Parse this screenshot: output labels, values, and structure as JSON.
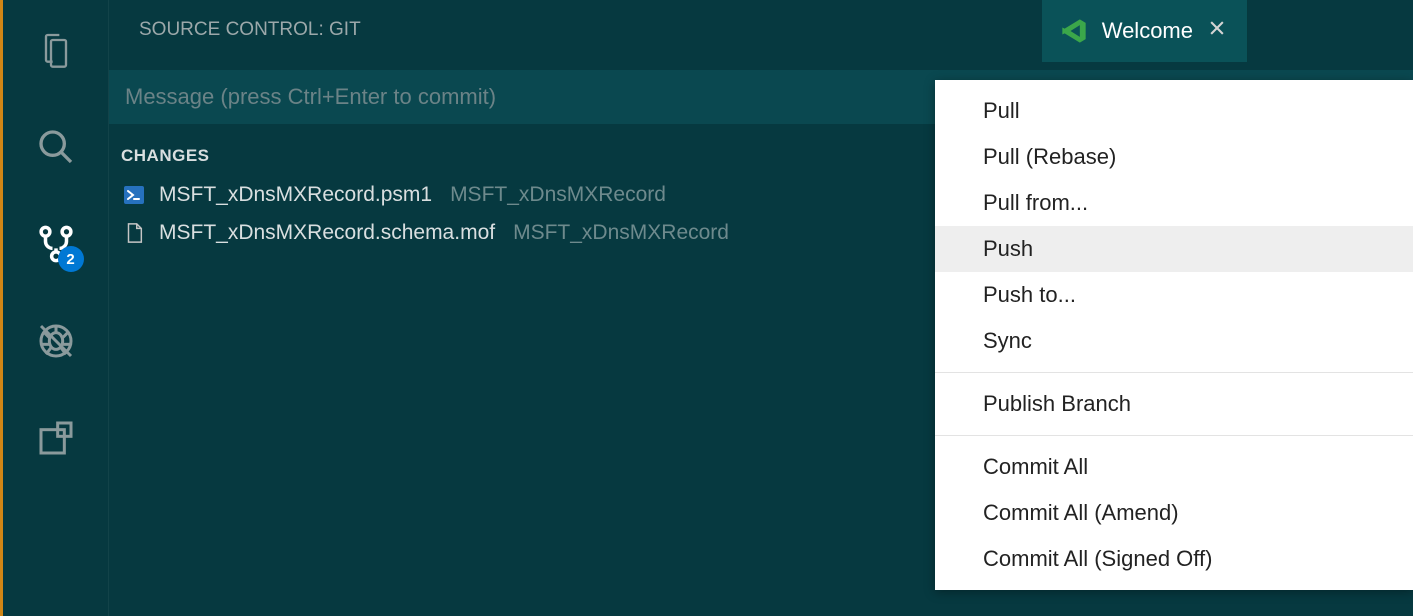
{
  "activity": {
    "scm_badge": "2"
  },
  "sidebar": {
    "title": "SOURCE CONTROL: GIT",
    "commit_placeholder": "Message (press Ctrl+Enter to commit)",
    "section_label": "CHANGES",
    "changes": [
      {
        "name": "MSFT_xDnsMXRecord.psm1",
        "dir": "MSFT_xDnsMXRecord",
        "icon": "powershell"
      },
      {
        "name": "MSFT_xDnsMXRecord.schema.mof",
        "dir": "MSFT_xDnsMXRecord",
        "icon": "file"
      }
    ]
  },
  "tab": {
    "label": "Welcome"
  },
  "menu": {
    "items": [
      {
        "label": "Pull",
        "hover": false
      },
      {
        "label": "Pull (Rebase)",
        "hover": false
      },
      {
        "label": "Pull from...",
        "hover": false
      },
      {
        "label": "Push",
        "hover": true
      },
      {
        "label": "Push to...",
        "hover": false
      },
      {
        "label": "Sync",
        "hover": false
      },
      {
        "sep": true
      },
      {
        "label": "Publish Branch",
        "hover": false
      },
      {
        "sep": true
      },
      {
        "label": "Commit All",
        "hover": false
      },
      {
        "label": "Commit All (Amend)",
        "hover": false
      },
      {
        "label": "Commit All (Signed Off)",
        "hover": false
      }
    ]
  }
}
